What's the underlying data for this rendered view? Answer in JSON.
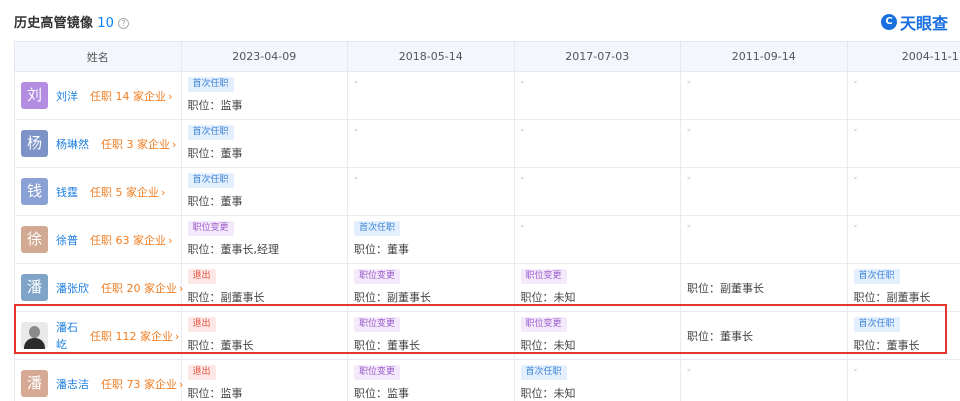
{
  "header": {
    "title": "历史高管镜像",
    "count": "10",
    "help": "?",
    "brand": "天眼查",
    "brand_mark": "C"
  },
  "columns": {
    "name": "姓名",
    "dates": [
      "2023-04-09",
      "2018-05-14",
      "2017-07-03",
      "2011-09-14",
      "2004-11-1"
    ]
  },
  "rows": [
    {
      "avatar": "刘",
      "avatar_color": "#b28de1",
      "name": "刘洋",
      "emp": "任职 14 家企业",
      "cells": [
        {
          "tag": "首次任职",
          "kind": "first",
          "pos": "职位：监事"
        },
        {
          "dash": "-"
        },
        {
          "dash": "-"
        },
        {
          "dash": "-"
        },
        {
          "dash": "-"
        }
      ]
    },
    {
      "avatar": "杨",
      "avatar_color": "#7d93c8",
      "name": "杨琳然",
      "emp": "任职 3 家企业",
      "cells": [
        {
          "tag": "首次任职",
          "kind": "first",
          "pos": "职位：董事"
        },
        {
          "dash": "-"
        },
        {
          "dash": "-"
        },
        {
          "dash": "-"
        },
        {
          "dash": "-"
        }
      ]
    },
    {
      "avatar": "钱",
      "avatar_color": "#8aa1d6",
      "name": "钱霆",
      "emp": "任职 5 家企业",
      "cells": [
        {
          "tag": "首次任职",
          "kind": "first",
          "pos": "职位：董事"
        },
        {
          "dash": "-"
        },
        {
          "dash": "-"
        },
        {
          "dash": "-"
        },
        {
          "dash": "-"
        }
      ]
    },
    {
      "avatar": "徐",
      "avatar_color": "#d2aa93",
      "name": "徐普",
      "emp": "任职 63 家企业",
      "cells": [
        {
          "tag": "职位变更",
          "kind": "change",
          "pos": "职位：董事长,经理"
        },
        {
          "tag": "首次任职",
          "kind": "first",
          "pos": "职位：董事"
        },
        {
          "dash": "-"
        },
        {
          "dash": "-"
        },
        {
          "dash": "-"
        }
      ]
    },
    {
      "avatar": "潘",
      "avatar_color": "#7fa4c8",
      "name": "潘张欣",
      "emp": "任职 20 家企业",
      "cells": [
        {
          "tag": "退出",
          "kind": "exit",
          "pos": "职位：副董事长"
        },
        {
          "tag": "职位变更",
          "kind": "change",
          "pos": "职位：副董事长"
        },
        {
          "tag": "职位变更",
          "kind": "change",
          "pos": "职位：未知"
        },
        {
          "pos": "职位：副董事长"
        },
        {
          "tag": "首次任职",
          "kind": "first",
          "pos": "职位：副董事长"
        }
      ]
    },
    {
      "photo": true,
      "name": "潘石屹",
      "emp": "任职 112 家企业",
      "cells": [
        {
          "tag": "退出",
          "kind": "exit",
          "pos": "职位：董事长"
        },
        {
          "tag": "职位变更",
          "kind": "change",
          "pos": "职位：董事长"
        },
        {
          "tag": "职位变更",
          "kind": "change",
          "pos": "职位：未知"
        },
        {
          "pos": "职位：董事长"
        },
        {
          "tag": "首次任职",
          "kind": "first",
          "pos": "职位：董事长"
        }
      ]
    },
    {
      "avatar": "潘",
      "avatar_color": "#d6a995",
      "name": "潘志洁",
      "emp": "任职 73 家企业",
      "cells": [
        {
          "tag": "退出",
          "kind": "exit",
          "pos": "职位：监事"
        },
        {
          "tag": "职位变更",
          "kind": "change",
          "pos": "职位：监事"
        },
        {
          "tag": "首次任职",
          "kind": "first",
          "pos": "职位：未知"
        },
        {
          "dash": "-"
        },
        {
          "dash": "-"
        }
      ]
    }
  ]
}
